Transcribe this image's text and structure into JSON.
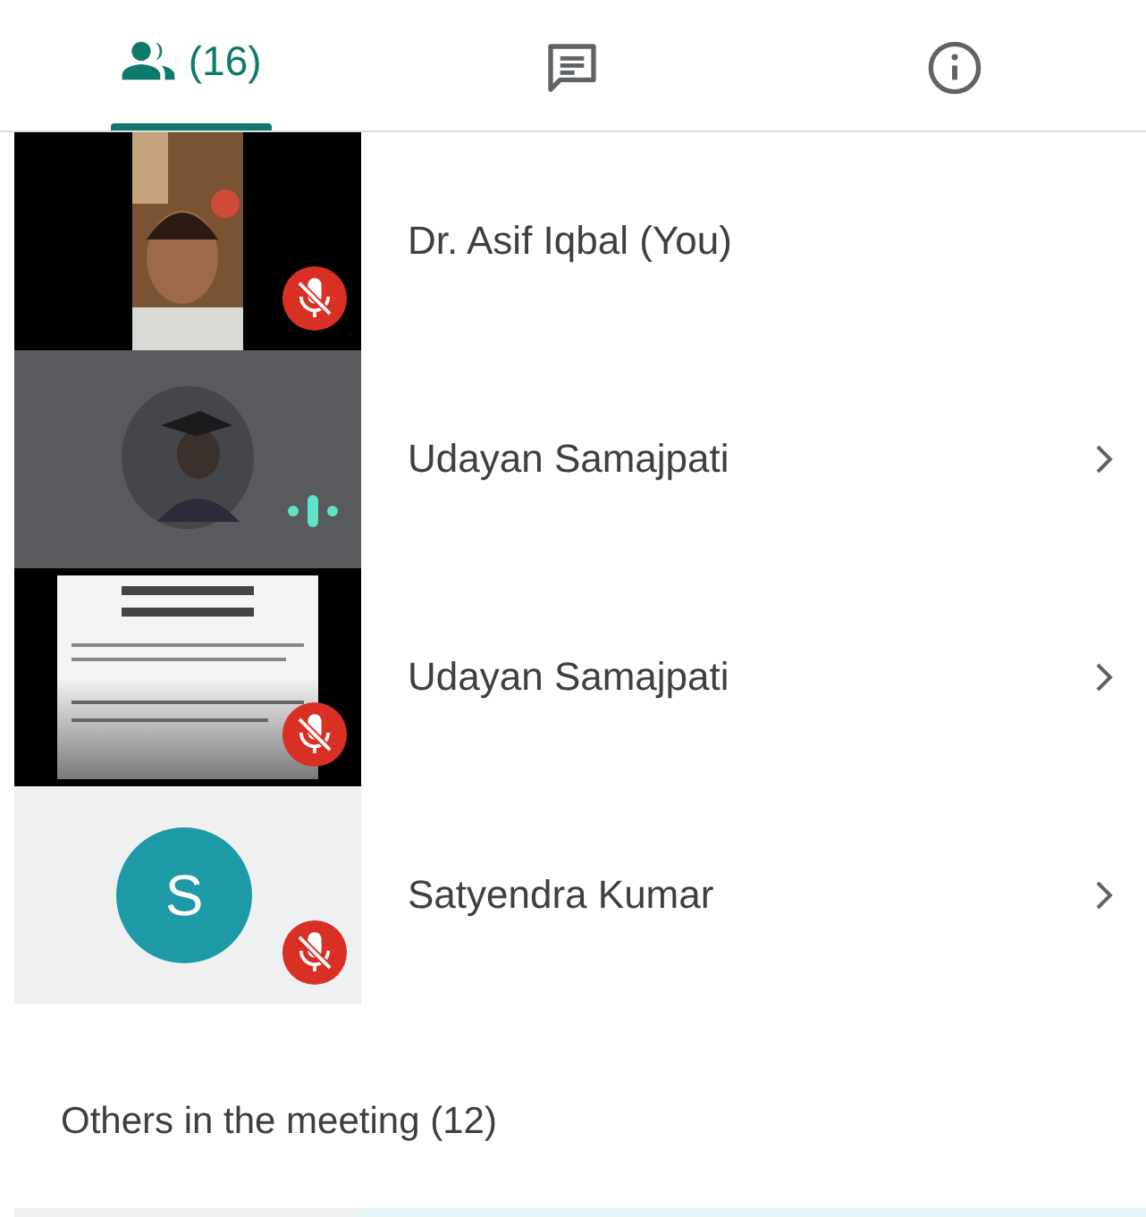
{
  "tabs": [
    {
      "kind": "people",
      "label": "(16)",
      "selected": true
    },
    {
      "kind": "chat",
      "selected": false
    },
    {
      "kind": "info",
      "selected": false
    }
  ],
  "participants": [
    {
      "name": "Dr. Asif Iqbal (You)",
      "muted": true,
      "speaking": false,
      "menu": false
    },
    {
      "name": "Udayan Samajpati",
      "muted": false,
      "speaking": true,
      "menu": true
    },
    {
      "name": "Udayan Samajpati",
      "muted": true,
      "speaking": false,
      "menu": true
    },
    {
      "name": "Satyendra Kumar",
      "tile": {
        "kind": "initial",
        "initial": "S",
        "color": "#1e9aa6"
      },
      "muted": true,
      "speaking": false,
      "menu": true
    }
  ],
  "others": {
    "heading": "Others in the meeting (12)",
    "rows": [
      {
        "highlighted": true
      }
    ]
  }
}
